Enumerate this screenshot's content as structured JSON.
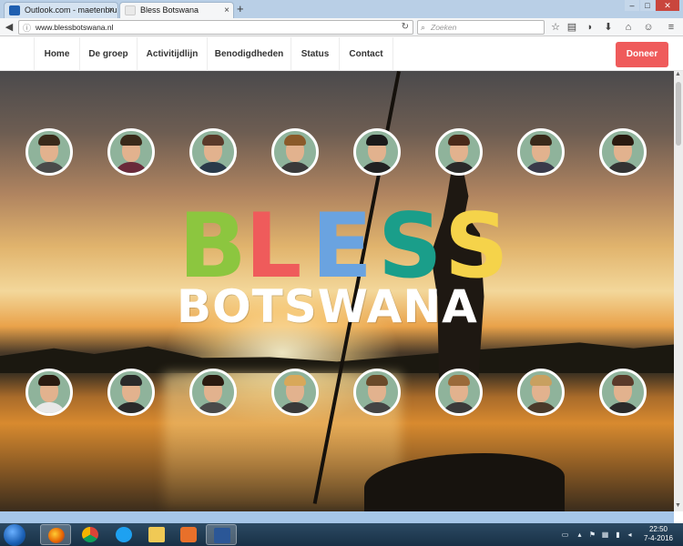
{
  "browser": {
    "tabs": [
      {
        "label": "Outlook.com - maetenbru...",
        "icon": "outlook-icon"
      },
      {
        "label": "Bless Botswana",
        "icon": "site-icon"
      }
    ],
    "new_tab": "+",
    "close_tab": "×",
    "url": "www.blessbotswana.nl",
    "search_placeholder": "Zoeken",
    "toolbar_icons": [
      "bookmark-star-icon",
      "reading-list-icon",
      "pocket-icon",
      "download-icon",
      "home-icon",
      "chat-icon",
      "menu-icon"
    ]
  },
  "site": {
    "menu": [
      "Home",
      "De groep",
      "Activitijdlijn",
      "Benodigdheden",
      "Status",
      "Contact"
    ],
    "donate_label": "Doneer",
    "title_word": "BLESS",
    "title_letter_colors": [
      "#8cc63f",
      "#ef5b5b",
      "#6aa3e0",
      "#1a9e8a",
      "#f5d34a"
    ],
    "subtitle": "BOTSWANA",
    "team_top": [
      {
        "name": "member-1"
      },
      {
        "name": "member-2"
      },
      {
        "name": "member-3"
      },
      {
        "name": "member-4"
      },
      {
        "name": "member-5"
      },
      {
        "name": "member-6"
      },
      {
        "name": "member-7"
      },
      {
        "name": "member-8"
      }
    ],
    "team_bottom": [
      {
        "name": "member-9"
      },
      {
        "name": "member-10"
      },
      {
        "name": "member-11"
      },
      {
        "name": "member-12"
      },
      {
        "name": "member-13"
      },
      {
        "name": "member-14"
      },
      {
        "name": "member-15"
      },
      {
        "name": "member-16"
      }
    ],
    "colors": {
      "accent": "#ef5b5b",
      "avatar_bg": "#8fb39b"
    }
  },
  "taskbar": {
    "apps": [
      "firefox-icon",
      "chrome-icon",
      "internet-explorer-icon",
      "file-explorer-icon",
      "media-player-icon",
      "word-icon"
    ],
    "time": "22:50",
    "date": "7-4-2016"
  }
}
